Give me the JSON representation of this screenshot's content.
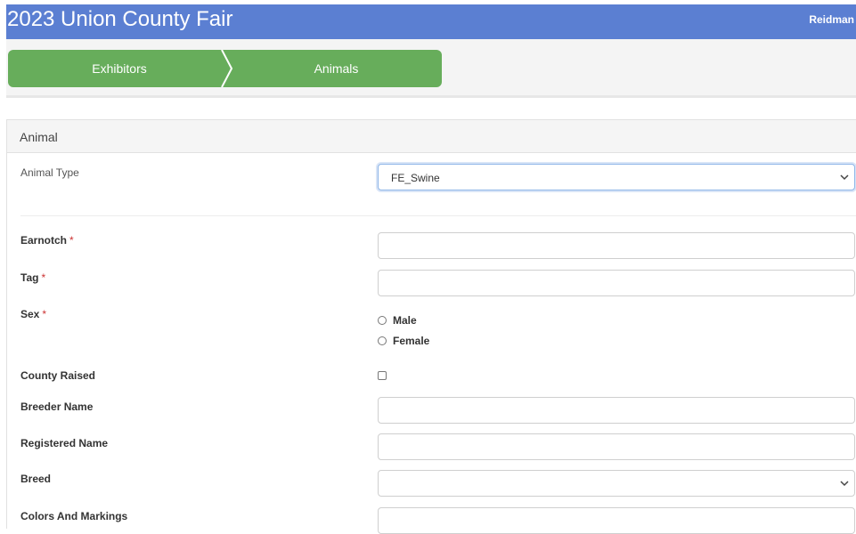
{
  "header": {
    "title": "2023 Union County Fair",
    "user": "Reidman"
  },
  "wizard": {
    "steps": [
      {
        "label": "Exhibitors"
      },
      {
        "label": "Animals"
      }
    ]
  },
  "colors": {
    "header_bg": "#5b7fd2",
    "wizard_bg": "#67ad5b",
    "required": "#cc3333"
  },
  "form": {
    "section_title": "Animal",
    "animal_type": {
      "label": "Animal Type",
      "value": "FE_Swine"
    },
    "earnotch": {
      "label": "Earnotch",
      "required_mark": "*",
      "value": ""
    },
    "tag": {
      "label": "Tag",
      "required_mark": "*",
      "value": ""
    },
    "sex": {
      "label": "Sex",
      "required_mark": "*",
      "options": [
        "Male",
        "Female"
      ],
      "selected": null
    },
    "county_raised": {
      "label": "County Raised",
      "checked": false
    },
    "breeder_name": {
      "label": "Breeder Name",
      "value": ""
    },
    "registered_name": {
      "label": "Registered Name",
      "value": ""
    },
    "breed": {
      "label": "Breed",
      "value": ""
    },
    "colors_and_markings": {
      "label": "Colors And Markings",
      "value": ""
    }
  }
}
